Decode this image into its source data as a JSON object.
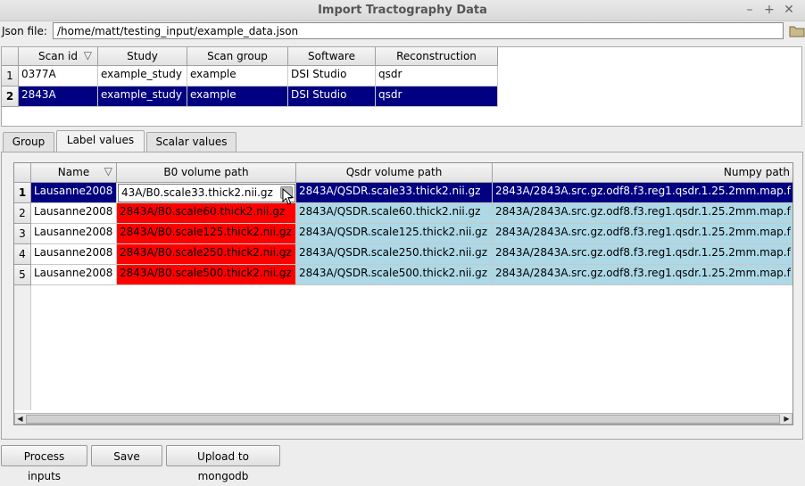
{
  "window": {
    "title": "Import Tractography Data"
  },
  "json_file": {
    "label": "Json file:",
    "value": "/home/matt/testing_input/example_data.json"
  },
  "scans": {
    "columns": [
      "Scan id",
      "Study",
      "Scan group",
      "Software",
      "Reconstruction"
    ],
    "rows": [
      {
        "num": "1",
        "cells": [
          "0377A",
          "example_study",
          "example",
          "DSI Studio",
          "qsdr"
        ]
      },
      {
        "num": "2",
        "cells": [
          "2843A",
          "example_study",
          "example",
          "DSI Studio",
          "qsdr"
        ]
      }
    ]
  },
  "tabs": [
    "Group",
    "Label values",
    "Scalar values"
  ],
  "active_tab": "Label values",
  "labels": {
    "columns": [
      "Name",
      "B0 volume path",
      "Qsdr volume path",
      "Numpy path"
    ],
    "editor_value": "43A/B0.scale33.thick2.nii.gz",
    "rows": [
      {
        "num": "1",
        "cells": [
          "Lausanne2008",
          "",
          "2843A/QSDR.scale33.thick2.nii.gz",
          "2843A/2843A.src.gz.odf8.f3.reg1.qsdr.1.25.2mm.map.f"
        ]
      },
      {
        "num": "2",
        "cells": [
          "Lausanne2008",
          "2843A/B0.scale60.thick2.nii.gz",
          "2843A/QSDR.scale60.thick2.nii.gz",
          "2843A/2843A.src.gz.odf8.f3.reg1.qsdr.1.25.2mm.map.f"
        ]
      },
      {
        "num": "3",
        "cells": [
          "Lausanne2008",
          "2843A/B0.scale125.thick2.nii.gz",
          "2843A/QSDR.scale125.thick2.nii.gz",
          "2843A/2843A.src.gz.odf8.f3.reg1.qsdr.1.25.2mm.map.f"
        ]
      },
      {
        "num": "4",
        "cells": [
          "Lausanne2008",
          "2843A/B0.scale250.thick2.nii.gz",
          "2843A/QSDR.scale250.thick2.nii.gz",
          "2843A/2843A.src.gz.odf8.f3.reg1.qsdr.1.25.2mm.map.f"
        ]
      },
      {
        "num": "5",
        "cells": [
          "Lausanne2008",
          "2843A/B0.scale500.thick2.nii.gz",
          "2843A/QSDR.scale500.thick2.nii.gz",
          "2843A/2843A.src.gz.odf8.f3.reg1.qsdr.1.25.2mm.map.f"
        ]
      }
    ]
  },
  "buttons": {
    "process": "Process inputs",
    "save": "Save",
    "upload": "Upload to mongodb"
  },
  "colors": {
    "selection": "#000080",
    "invalid_path": "#ff0000",
    "valid_path": "#add8e6"
  }
}
